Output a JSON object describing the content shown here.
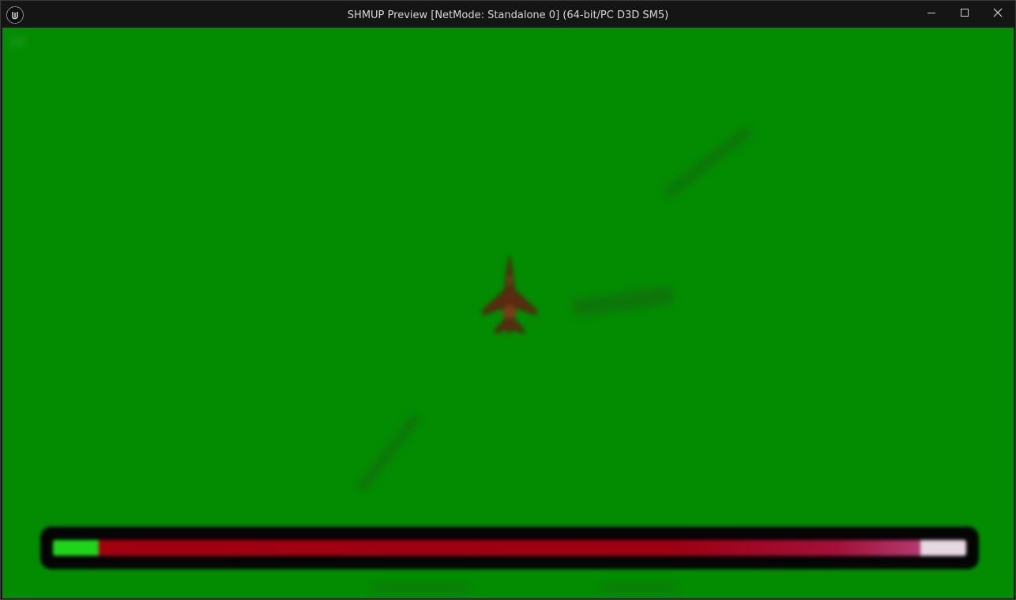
{
  "window": {
    "title": "SHMUP Preview [NetMode: Standalone 0]  (64-bit/PC D3D SM5)",
    "icon": "unreal-engine-icon",
    "controls": {
      "minimize": "minimize-icon",
      "maximize": "maximize-icon",
      "close": "close-icon"
    }
  },
  "game": {
    "background_color": "#038c02",
    "player": {
      "icon": "fighter-jet-icon",
      "color": "#5a2a10"
    },
    "health_bar": {
      "value": 0.05,
      "remaining_damage_fraction": 0.9,
      "colors": {
        "health": "#1fd41a",
        "damage": "#a30010",
        "empty": "#e6d8e0"
      }
    }
  }
}
